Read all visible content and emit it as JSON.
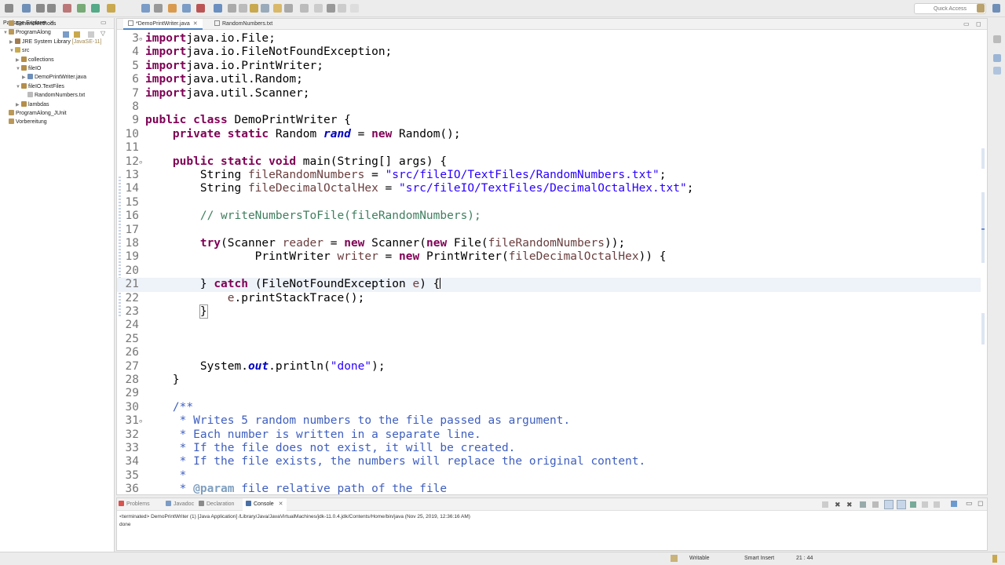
{
  "toolbar": {
    "quick_access_placeholder": "Quick Access"
  },
  "package_explorer": {
    "tab_label": "Package Explorer",
    "tab_close": "✕",
    "tree": [
      {
        "label": "GenericMethods",
        "level": 0,
        "twisty": "",
        "icon": "project"
      },
      {
        "label": "ProgramAlong",
        "level": 0,
        "twisty": "▼",
        "icon": "project"
      },
      {
        "label": "JRE System Library",
        "decoration": "[JavaSE-11]",
        "level": 1,
        "twisty": "▶",
        "icon": "library"
      },
      {
        "label": "src",
        "level": 1,
        "twisty": "▼",
        "icon": "folder"
      },
      {
        "label": "collections",
        "level": 2,
        "twisty": "▶",
        "icon": "package"
      },
      {
        "label": "fileIO",
        "level": 2,
        "twisty": "▼",
        "icon": "package"
      },
      {
        "label": "DemoPrintWriter.java",
        "level": 3,
        "twisty": "▶",
        "icon": "java"
      },
      {
        "label": "fileIO.TextFiles",
        "level": 2,
        "twisty": "▼",
        "icon": "package"
      },
      {
        "label": "RandomNumbers.txt",
        "level": 3,
        "twisty": "",
        "icon": "text"
      },
      {
        "label": "lambdas",
        "level": 2,
        "twisty": "▶",
        "icon": "package"
      },
      {
        "label": "ProgramAlong_JUnit",
        "level": 0,
        "twisty": "",
        "icon": "project"
      },
      {
        "label": "Vorbereitung",
        "level": 0,
        "twisty": "",
        "icon": "project"
      }
    ]
  },
  "editor": {
    "tabs": [
      {
        "label": "*DemoPrintWriter.java",
        "close": "✕",
        "active": true
      },
      {
        "label": "RandomNumbers.txt",
        "close": "",
        "active": false
      }
    ],
    "lines": [
      {
        "num": "3",
        "fold": "⊖",
        "segs": [
          [
            "kw",
            "import"
          ],
          [
            "",
            "java.io.File;"
          ]
        ]
      },
      {
        "num": "4",
        "segs": [
          [
            "kw",
            "import"
          ],
          [
            "",
            "java.io.FileNotFoundException;"
          ]
        ]
      },
      {
        "num": "5",
        "segs": [
          [
            "kw",
            "import"
          ],
          [
            "",
            "java.io.PrintWriter;"
          ]
        ]
      },
      {
        "num": "6",
        "segs": [
          [
            "kw",
            "import"
          ],
          [
            "",
            "java.util.Random;"
          ]
        ]
      },
      {
        "num": "7",
        "segs": [
          [
            "kw",
            "import"
          ],
          [
            "",
            "java.util.Scanner;"
          ]
        ]
      },
      {
        "num": "8",
        "segs": []
      },
      {
        "num": "9",
        "segs": [
          [
            "kw",
            "public class"
          ],
          [
            "",
            " DemoPrintWriter {"
          ]
        ]
      },
      {
        "num": "10",
        "segs": [
          [
            "",
            "    "
          ],
          [
            "kw",
            "private static"
          ],
          [
            "",
            " Random "
          ],
          [
            "sfld",
            "rand"
          ],
          [
            "",
            " = "
          ],
          [
            "kw",
            "new"
          ],
          [
            "",
            " Random();"
          ]
        ]
      },
      {
        "num": "11",
        "segs": []
      },
      {
        "num": "12",
        "fold": "⊖",
        "segs": [
          [
            "",
            "    "
          ],
          [
            "kw",
            "public static void"
          ],
          [
            "",
            " main(String[] args) {"
          ]
        ]
      },
      {
        "num": "13",
        "segs": [
          [
            "",
            "        String "
          ],
          [
            "var",
            "fileRandomNumbers"
          ],
          [
            "",
            " = "
          ],
          [
            "str",
            "\"src/fileIO/TextFiles/RandomNumbers.txt\""
          ],
          [
            "",
            ";"
          ]
        ]
      },
      {
        "num": "14",
        "segs": [
          [
            "",
            "        String "
          ],
          [
            "var",
            "fileDecimalOctalHex"
          ],
          [
            "",
            " = "
          ],
          [
            "str",
            "\"src/fileIO/TextFiles/DecimalOctalHex.txt\""
          ],
          [
            "",
            ";"
          ]
        ]
      },
      {
        "num": "15",
        "segs": []
      },
      {
        "num": "16",
        "segs": [
          [
            "",
            "        "
          ],
          [
            "cm",
            "// writeNumbersToFile(fileRandomNumbers);"
          ]
        ]
      },
      {
        "num": "17",
        "segs": []
      },
      {
        "num": "18",
        "segs": [
          [
            "",
            "        "
          ],
          [
            "kw",
            "try"
          ],
          [
            "",
            "(Scanner "
          ],
          [
            "var",
            "reader"
          ],
          [
            "",
            " = "
          ],
          [
            "kw",
            "new"
          ],
          [
            "",
            " Scanner("
          ],
          [
            "kw",
            "new"
          ],
          [
            "",
            " File("
          ],
          [
            "var",
            "fileRandomNumbers"
          ],
          [
            "",
            "));"
          ]
        ]
      },
      {
        "num": "19",
        "segs": [
          [
            "",
            "                PrintWriter "
          ],
          [
            "var",
            "writer"
          ],
          [
            "",
            " = "
          ],
          [
            "kw",
            "new"
          ],
          [
            "",
            " PrintWriter("
          ],
          [
            "var",
            "fileDecimalOctalHex"
          ],
          [
            "",
            ")) {"
          ]
        ]
      },
      {
        "num": "20",
        "segs": []
      },
      {
        "num": "21",
        "current": true,
        "segs": [
          [
            "",
            "        } "
          ],
          [
            "kw",
            "catch"
          ],
          [
            "",
            " (FileNotFoundException "
          ],
          [
            "var",
            "e"
          ],
          [
            "",
            ") {"
          ],
          [
            "caret",
            ""
          ]
        ]
      },
      {
        "num": "22",
        "segs": [
          [
            "",
            "            "
          ],
          [
            "var",
            "e"
          ],
          [
            "",
            ".printStackTrace();"
          ]
        ]
      },
      {
        "num": "23",
        "segs": [
          [
            "",
            "        "
          ],
          [
            "box",
            "}"
          ]
        ]
      },
      {
        "num": "24",
        "segs": []
      },
      {
        "num": "25",
        "segs": []
      },
      {
        "num": "26",
        "segs": []
      },
      {
        "num": "27",
        "segs": [
          [
            "",
            "        System."
          ],
          [
            "sfld",
            "out"
          ],
          [
            "",
            ".println("
          ],
          [
            "str",
            "\"done\""
          ],
          [
            "",
            ");"
          ]
        ]
      },
      {
        "num": "28",
        "segs": [
          [
            "",
            "    }"
          ]
        ]
      },
      {
        "num": "29",
        "segs": []
      },
      {
        "num": "30",
        "segs": [
          [
            "",
            "    "
          ],
          [
            "jd",
            "/**"
          ]
        ]
      },
      {
        "num": "31",
        "fold": "⊖",
        "segs": [
          [
            "",
            "     "
          ],
          [
            "jd",
            "* Writes 5 random numbers to the file passed as argument."
          ]
        ]
      },
      {
        "num": "32",
        "segs": [
          [
            "",
            "     "
          ],
          [
            "jd",
            "* Each number is written in a separate line."
          ]
        ]
      },
      {
        "num": "33",
        "segs": [
          [
            "",
            "     "
          ],
          [
            "jd",
            "* If the file does not exist, it will be created."
          ]
        ]
      },
      {
        "num": "34",
        "segs": [
          [
            "",
            "     "
          ],
          [
            "jd",
            "* If the file exists, the numbers will replace the original content."
          ]
        ]
      },
      {
        "num": "35",
        "segs": [
          [
            "",
            "     "
          ],
          [
            "jd",
            "*"
          ]
        ]
      },
      {
        "num": "36",
        "segs": [
          [
            "",
            "     "
          ],
          [
            "jd",
            "* "
          ],
          [
            "jdt",
            "@param"
          ],
          [
            "jd",
            " file relative path of the file"
          ]
        ]
      }
    ]
  },
  "console": {
    "tabs": [
      {
        "label": "Problems",
        "active": false,
        "icon_color": "#d9534f"
      },
      {
        "label": "Javadoc",
        "active": false,
        "icon_color": "#7a9cc6"
      },
      {
        "label": "Declaration",
        "active": false,
        "icon_color": "#8a8a8a"
      },
      {
        "label": "Console",
        "active": true,
        "icon_color": "#4a6fa5",
        "close": "✕"
      }
    ],
    "header": "<terminated> DemoPrintWriter (1) [Java Application] /Library/Java/JavaVirtualMachines/jdk-11.0.4.jdk/Contents/Home/bin/java (Nov 25, 2019, 12:36:16 AM)",
    "output": "done"
  },
  "statusbar": {
    "writable": "Writable",
    "insert_mode": "Smart Insert",
    "position": "21 : 44"
  }
}
